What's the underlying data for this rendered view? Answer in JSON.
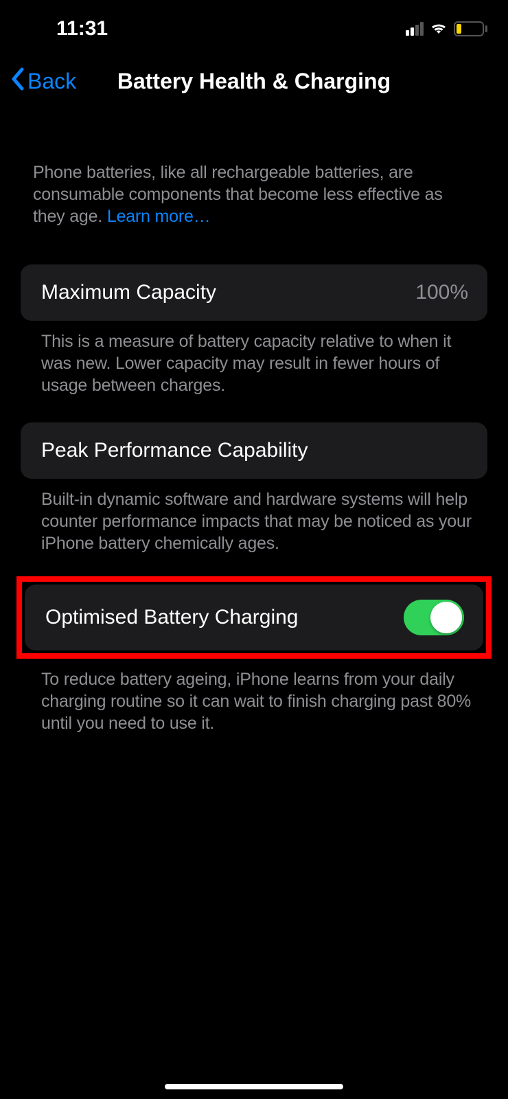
{
  "statusBar": {
    "time": "11:31"
  },
  "nav": {
    "back": "Back",
    "title": "Battery Health & Charging"
  },
  "intro": {
    "text": "Phone batteries, like all rechargeable batteries, are consumable components that become less effective as they age. ",
    "learnMore": "Learn more…"
  },
  "maxCapacity": {
    "label": "Maximum Capacity",
    "value": "100%",
    "footer": "This is a measure of battery capacity relative to when it was new. Lower capacity may result in fewer hours of usage between charges."
  },
  "peakPerf": {
    "label": "Peak Performance Capability",
    "footer": "Built-in dynamic software and hardware systems will help counter performance impacts that may be noticed as your iPhone battery chemically ages."
  },
  "optimised": {
    "label": "Optimised Battery Charging",
    "toggleOn": true,
    "footer": "To reduce battery ageing, iPhone learns from your daily charging routine so it can wait to finish charging past 80% until you need to use it."
  }
}
